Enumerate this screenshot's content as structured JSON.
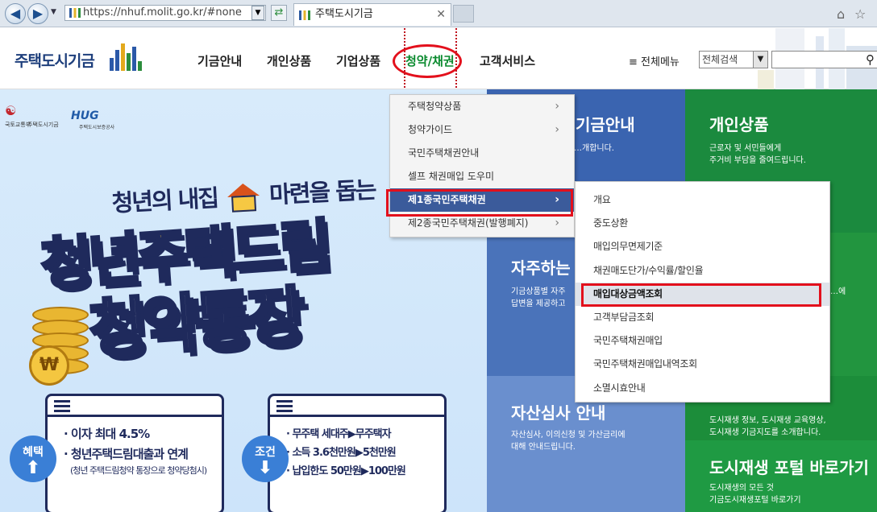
{
  "browser": {
    "url": "https://nhuf.molit.go.kr/#none",
    "tab_title": "주택도시기금",
    "back_glyph": "◀",
    "forward_glyph": "▶",
    "dropdown_glyph": "▼",
    "refresh_glyph": "⇄",
    "close_glyph": "✕",
    "home_glyph": "⌂",
    "star_glyph": "☆"
  },
  "header": {
    "logo_text": "주택도시기금",
    "nav": [
      {
        "label": "기금안내"
      },
      {
        "label": "개인상품"
      },
      {
        "label": "기업상품"
      },
      {
        "label": "청약/채권",
        "active": true
      },
      {
        "label": "고객서비스"
      }
    ],
    "all_menu": "≡ 전체메뉴",
    "search_select": "전체검색",
    "search_icon_glyph": "⚲"
  },
  "banner": {
    "emblem1": "국토교통부",
    "emblem2": "주택도시기금",
    "hug_logo": "HUG",
    "hug_sub": "주택도시보증공사",
    "tagline_left": "청년의 내집",
    "tagline_right": "마련을 돕는",
    "headline1": "청년주택드림",
    "headline2": "청약통장",
    "coin_symbol": "₩",
    "benefit_badge": "혜택",
    "benefit_lines": [
      "· 이자 최대 4.5%",
      "· 청년주택드림대출과 연계"
    ],
    "benefit_note": "(청년 주택드림청약 통장으로 청약당첨시)",
    "condition_badge": "조건",
    "condition_lines": [
      "· 무주택 세대주▶무주택자",
      "· 소득 3.6천만원▶5천만원",
      "· 납입한도 50만원▶100만원"
    ],
    "arrow_glyph": "⬆",
    "arrow_down_glyph": "⬇"
  },
  "tiles": [
    {
      "title": "기금안내",
      "desc": "…개합니다.",
      "color": "#3a64b0"
    },
    {
      "title": "개인상품",
      "desc": "근로자 및 서민들에게\n주거비 부담을 줄여드립니다.",
      "color": "#1b8a3e"
    },
    {
      "title": "자주하는",
      "desc": "기금상품별 자주\n답변을 제공하고",
      "color": "#4a73ba"
    },
    {
      "title": "",
      "desc": "…에",
      "color": "#22953f"
    },
    {
      "title": "자산심사 안내",
      "desc": "자산심사, 이의신청 및 가산금리에\n대해 안내드립니다.",
      "color": "#6a8fce"
    },
    {
      "title": "",
      "desc": "도시재생 정보, 도시재생 교육영상,\n도시재생 기금지도를 소개합니다.",
      "color": "#1c8d3a"
    },
    {
      "title": "도시재생 포털 바로가기",
      "desc": "도시재생의 모든 것\n기금도시재생포털 바로가기",
      "color": "#1f9a43"
    }
  ],
  "submenu1": [
    {
      "label": "주택청약상품",
      "arrow": true
    },
    {
      "label": "청약가이드",
      "arrow": true
    },
    {
      "label": "국민주택채권안내",
      "arrow": false
    },
    {
      "label": "셀프 채권매입 도우미",
      "arrow": false
    },
    {
      "label": "제1종국민주택채권",
      "arrow": true,
      "selected": true
    },
    {
      "label": "제2종국민주택채권(발행폐지)",
      "arrow": true
    }
  ],
  "submenu2": [
    {
      "label": "개요"
    },
    {
      "label": "중도상환"
    },
    {
      "label": "매입의무면제기준"
    },
    {
      "label": "채권매도단가/수익률/할인율"
    },
    {
      "label": "매입대상금액조회",
      "selected": true
    },
    {
      "label": "고객부담금조회"
    },
    {
      "label": "국민주택채권매입"
    },
    {
      "label": "국민주택채권매입내역조회"
    },
    {
      "label": "소멸시효안내"
    }
  ],
  "arrow_right": "›"
}
